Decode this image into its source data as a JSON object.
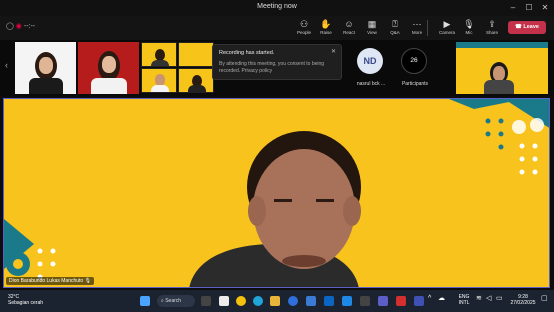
{
  "window": {
    "title": "Meeting now"
  },
  "toolbar": {
    "timer": "--:--",
    "items": [
      {
        "label": "People",
        "icon": "people-icon"
      },
      {
        "label": "Raise",
        "icon": "raise-hand-icon"
      },
      {
        "label": "React",
        "icon": "react-icon"
      },
      {
        "label": "View",
        "icon": "view-grid-icon"
      },
      {
        "label": "Q&A",
        "icon": "qa-icon"
      },
      {
        "label": "More",
        "icon": "more-icon"
      },
      {
        "label": "Camera",
        "icon": "camera-icon"
      },
      {
        "label": "Mic",
        "icon": "mic-icon"
      },
      {
        "label": "Share",
        "icon": "share-icon"
      }
    ],
    "leave": "Leave"
  },
  "toast": {
    "title": "Recording has started.",
    "body": "By attending this meeting, you consent to being recorded. Privacy policy"
  },
  "participant": {
    "initials": "ND",
    "name": "nasrul bck ..."
  },
  "participants": {
    "count": "26",
    "label": "Participants"
  },
  "speaker": {
    "name": "Dion Barabundo Lukas Manchuto"
  },
  "taskbar": {
    "weather_temp": "32°C",
    "weather_desc": "Sebagian cerah",
    "search": "Search",
    "lang": "ENG",
    "lang2": "INTL",
    "time": "9:28",
    "date": "27/02/2025"
  },
  "colors": {
    "accent": "#5b5fc7",
    "leave": "#c4314b",
    "slide_yellow": "#f7c31c",
    "slide_teal": "#1b7a8a"
  }
}
